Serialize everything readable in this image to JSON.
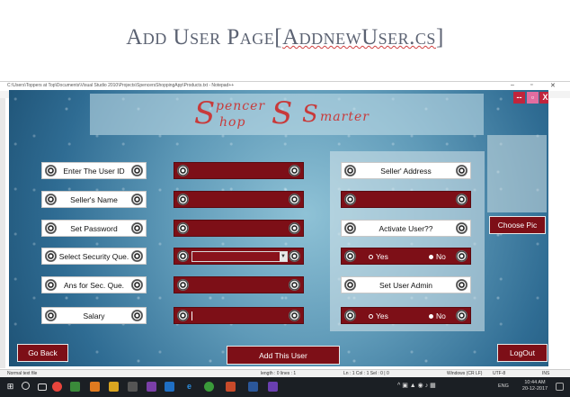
{
  "slide": {
    "title_prefix": "Add User Page[",
    "title_link": "AddnewUser.cs",
    "title_suffix": "]"
  },
  "notepad": {
    "title": "C:\\Users\\Toppers at Top\\Documents\\Visual Studio 2010\\Projects\\SpencersShoppingApp\\Products.txt - Notepad++",
    "status_left": "Normal text file",
    "status_length": "length : 0   lines : 1",
    "status_pos": "Ln : 1   Col : 1   Sel : 0 | 0",
    "status_eol": "Windows (CR LF)",
    "status_enc": "UTF-8",
    "status_mode": "INS"
  },
  "app": {
    "logo_top": "pencer",
    "logo_bottom": "hop",
    "logo_s1": "S",
    "logo_s2": "S",
    "logo_right1": "marter",
    "logo_right_s": "S",
    "win_min": "--",
    "win_max": "▫",
    "win_close": "X",
    "labels": {
      "user_id": "Enter The User ID",
      "seller_name": "Seller's Name",
      "password": "Set Password",
      "security_que": "Select Security Que.",
      "ans_sec": "Ans for Sec. Que.",
      "salary": "Salary",
      "seller_address": "Seller' Address",
      "activate_user": "Activate User??",
      "set_admin": "Set User Admin"
    },
    "activate_radio": {
      "yes": "Yes",
      "no": "No",
      "selected": "No"
    },
    "admin_radio": {
      "yes": "Yes",
      "no": "No",
      "selected": "No"
    },
    "buttons": {
      "choose_pic": "Choose Pic",
      "go_back": "Go Back",
      "add_user": "Add This User",
      "logout": "LogOut"
    }
  },
  "taskbar": {
    "time": "10:44 AM",
    "date": "20-12-2017",
    "lang": "ENG"
  }
}
